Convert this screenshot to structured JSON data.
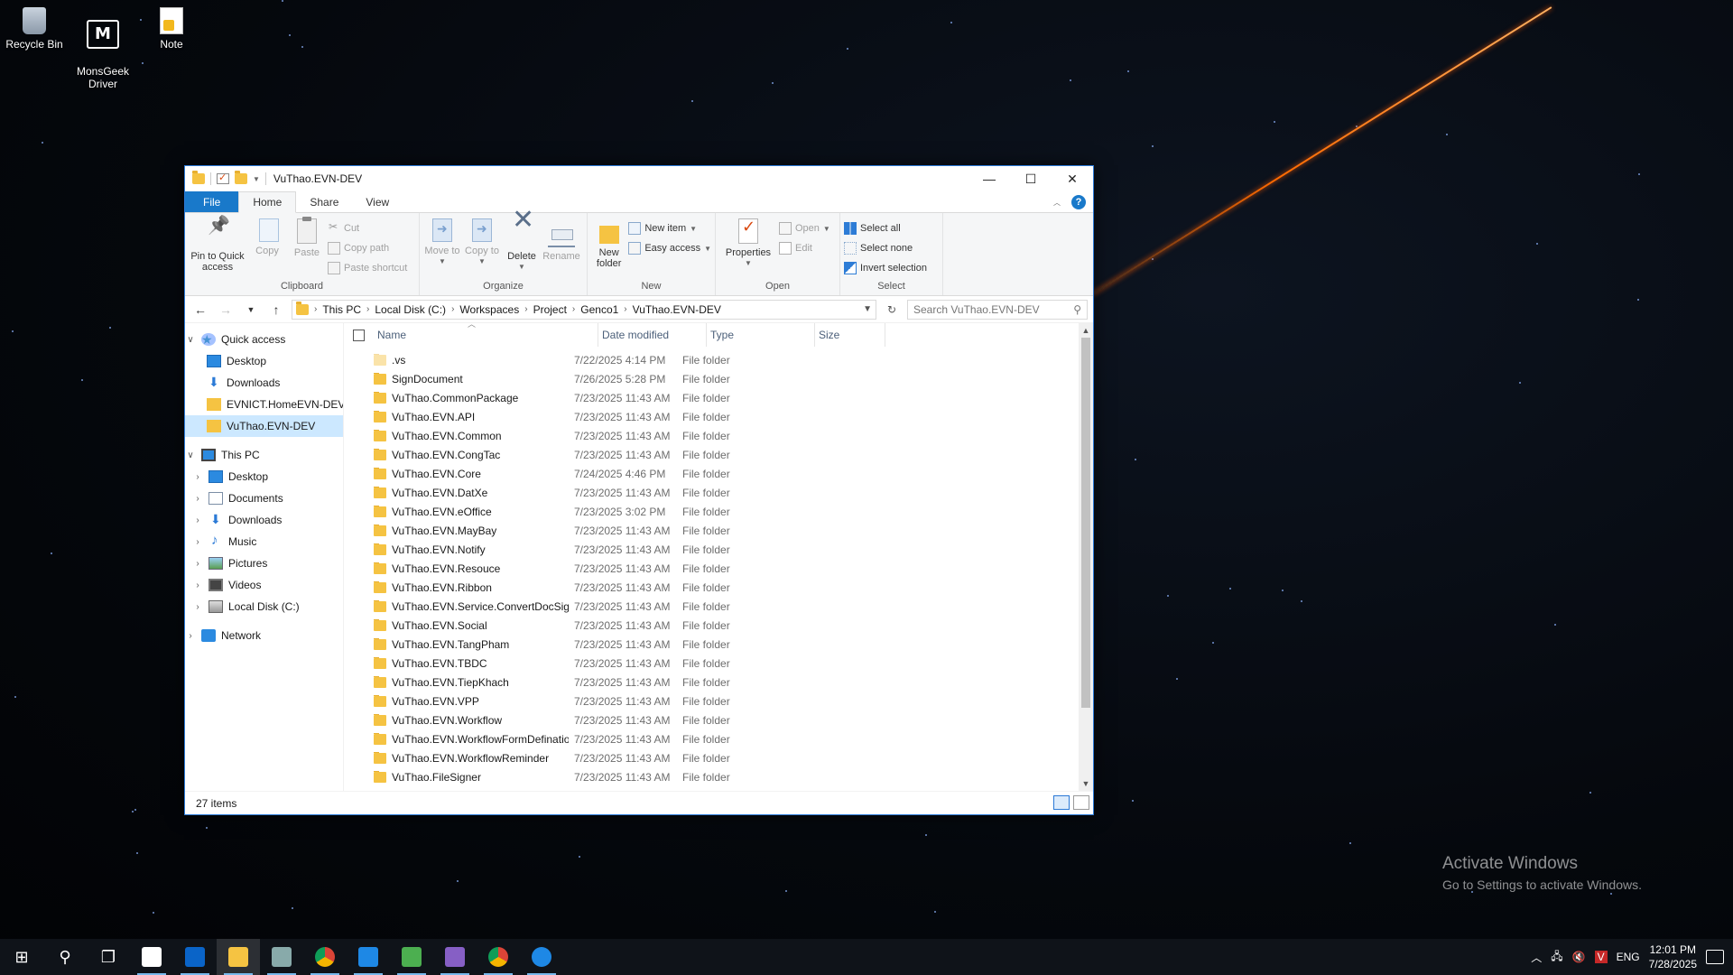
{
  "desktop": {
    "icons": [
      {
        "label": "Recycle Bin"
      },
      {
        "label": "MonsGeek\nDriver"
      },
      {
        "label": "Note"
      }
    ],
    "watermark": {
      "line1": "Activate Windows",
      "line2": "Go to Settings to activate Windows."
    }
  },
  "window": {
    "title": "VuThao.EVN-DEV",
    "tabs": {
      "file": "File",
      "home": "Home",
      "share": "Share",
      "view": "View"
    },
    "ribbon": {
      "clipboard": {
        "label": "Clipboard",
        "pin": "Pin to Quick access",
        "copy": "Copy",
        "paste": "Paste",
        "cut": "Cut",
        "copy_path": "Copy path",
        "paste_shortcut": "Paste shortcut"
      },
      "organize": {
        "label": "Organize",
        "move_to": "Move to",
        "copy_to": "Copy to",
        "delete": "Delete",
        "rename": "Rename"
      },
      "new": {
        "label": "New",
        "new_folder": "New folder",
        "new_item": "New item",
        "easy_access": "Easy access"
      },
      "open": {
        "label": "Open",
        "properties": "Properties",
        "open": "Open",
        "edit": "Edit"
      },
      "select": {
        "label": "Select",
        "select_all": "Select all",
        "select_none": "Select none",
        "invert": "Invert selection"
      }
    },
    "address": {
      "crumbs": [
        "This PC",
        "Local Disk (C:)",
        "Workspaces",
        "Project",
        "Genco1",
        "VuThao.EVN-DEV"
      ],
      "search_placeholder": "Search VuThao.EVN-DEV"
    },
    "nav": {
      "quick_access": "Quick access",
      "quick_items": [
        "Desktop",
        "Downloads",
        "EVNICT.HomeEVN-DEV",
        "VuThao.EVN-DEV"
      ],
      "this_pc": "This PC",
      "pc_items": [
        "Desktop",
        "Documents",
        "Downloads",
        "Music",
        "Pictures",
        "Videos",
        "Local Disk (C:)"
      ],
      "network": "Network"
    },
    "columns": {
      "name": "Name",
      "date": "Date modified",
      "type": "Type",
      "size": "Size"
    },
    "files": [
      {
        "name": ".vs",
        "date": "7/22/2025 4:14 PM",
        "type": "File folder"
      },
      {
        "name": "SignDocument",
        "date": "7/26/2025 5:28 PM",
        "type": "File folder"
      },
      {
        "name": "VuThao.CommonPackage",
        "date": "7/23/2025 11:43 AM",
        "type": "File folder"
      },
      {
        "name": "VuThao.EVN.API",
        "date": "7/23/2025 11:43 AM",
        "type": "File folder"
      },
      {
        "name": "VuThao.EVN.Common",
        "date": "7/23/2025 11:43 AM",
        "type": "File folder"
      },
      {
        "name": "VuThao.EVN.CongTac",
        "date": "7/23/2025 11:43 AM",
        "type": "File folder"
      },
      {
        "name": "VuThao.EVN.Core",
        "date": "7/24/2025 4:46 PM",
        "type": "File folder"
      },
      {
        "name": "VuThao.EVN.DatXe",
        "date": "7/23/2025 11:43 AM",
        "type": "File folder"
      },
      {
        "name": "VuThao.EVN.eOffice",
        "date": "7/23/2025 3:02 PM",
        "type": "File folder"
      },
      {
        "name": "VuThao.EVN.MayBay",
        "date": "7/23/2025 11:43 AM",
        "type": "File folder"
      },
      {
        "name": "VuThao.EVN.Notify",
        "date": "7/23/2025 11:43 AM",
        "type": "File folder"
      },
      {
        "name": "VuThao.EVN.Resouce",
        "date": "7/23/2025 11:43 AM",
        "type": "File folder"
      },
      {
        "name": "VuThao.EVN.Ribbon",
        "date": "7/23/2025 11:43 AM",
        "type": "File folder"
      },
      {
        "name": "VuThao.EVN.Service.ConvertDocSign",
        "date": "7/23/2025 11:43 AM",
        "type": "File folder"
      },
      {
        "name": "VuThao.EVN.Social",
        "date": "7/23/2025 11:43 AM",
        "type": "File folder"
      },
      {
        "name": "VuThao.EVN.TangPham",
        "date": "7/23/2025 11:43 AM",
        "type": "File folder"
      },
      {
        "name": "VuThao.EVN.TBDC",
        "date": "7/23/2025 11:43 AM",
        "type": "File folder"
      },
      {
        "name": "VuThao.EVN.TiepKhach",
        "date": "7/23/2025 11:43 AM",
        "type": "File folder"
      },
      {
        "name": "VuThao.EVN.VPP",
        "date": "7/23/2025 11:43 AM",
        "type": "File folder"
      },
      {
        "name": "VuThao.EVN.Workflow",
        "date": "7/23/2025 11:43 AM",
        "type": "File folder"
      },
      {
        "name": "VuThao.EVN.WorkflowFormDefination",
        "date": "7/23/2025 11:43 AM",
        "type": "File folder"
      },
      {
        "name": "VuThao.EVN.WorkflowReminder",
        "date": "7/23/2025 11:43 AM",
        "type": "File folder"
      },
      {
        "name": "VuThao.FileSigner",
        "date": "7/23/2025 11:43 AM",
        "type": "File folder"
      }
    ],
    "status": "27 items"
  },
  "taskbar": {
    "language": "ENG",
    "time": "12:01 PM",
    "date": "7/28/2025"
  },
  "colors": {
    "accent": "#1979ca",
    "selection": "#cce8ff",
    "folder": "#f5c342"
  }
}
